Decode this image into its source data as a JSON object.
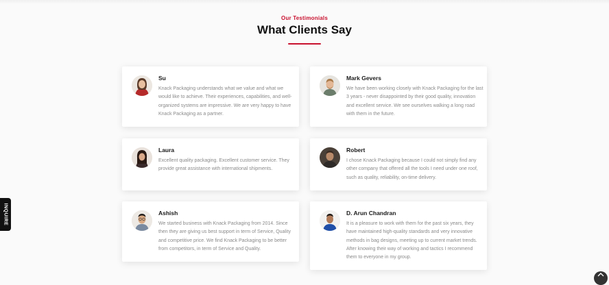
{
  "section": {
    "eyebrow": "Our Testimonials",
    "title": "What Clients Say"
  },
  "testimonials": [
    {
      "name": "Su",
      "quote": "Knack Packaging understands what we value and what we would like to achieve. Their experiences, capabilities, and well-organized systems are impressive. We are very happy to have Knack Packaging as a partner.",
      "avatar": "woman-red-jacket-avatar"
    },
    {
      "name": "Mark Gevers",
      "quote": "We have been working closely with Knack Packaging for the last 3 years - never disappointed by their good quality, innovation and excellent service. We see ourselves walking a long road with them in the future.",
      "avatar": "man-beard-avatar"
    },
    {
      "name": "Laura",
      "quote": "Excellent quality packaging. Excellent customer service. They provide great assistance with international shipments.",
      "avatar": "woman-dark-hair-avatar"
    },
    {
      "name": "Robert",
      "quote": "I chose Knack Packaging because I could not simply find any other company that offered all the tools I need under one roof, such as quality, reliability, on-time delivery.",
      "avatar": "man-dark-avatar"
    },
    {
      "name": "Ashish",
      "quote": "We started business with Knack Packaging from 2014. Since then they are giving us best support in term of Service, Quality and competitive price. We find Knack Packaging to be better from competitors, in term of Service and Quality.",
      "avatar": "man-glasses-avatar"
    },
    {
      "name": "D. Arun Chandran",
      "quote": "It is a pleasure to work with them for the past six years, they have maintained high-quality standards and very innovative methods in bag designs, meeting up to current market trends. After knowing their way of working and tactics I recommend them to everyone in my group.",
      "avatar": "man-blue-shirt-avatar"
    }
  ],
  "inquire_tab": {
    "label": "INQUIRE"
  },
  "colors": {
    "accent": "#c8102e",
    "heading": "#111111",
    "body_text": "#8a8a8a"
  }
}
